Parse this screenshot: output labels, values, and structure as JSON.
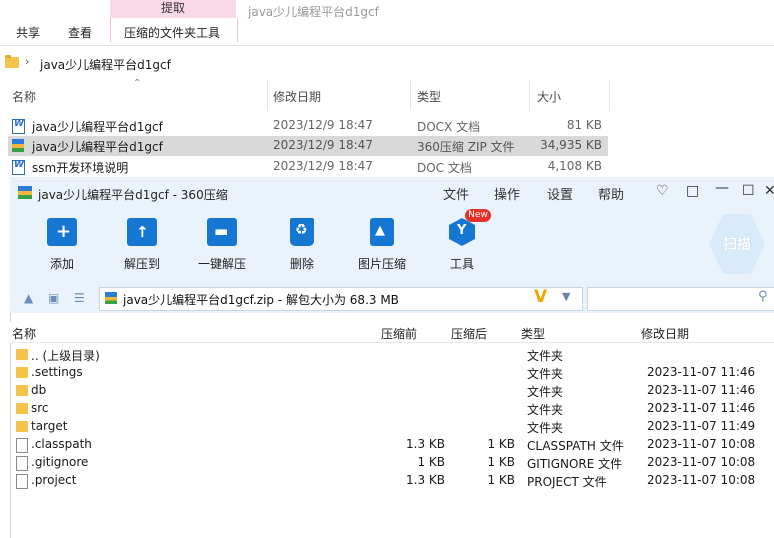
{
  "explorer": {
    "window_title": "java少儿编程平台d1gcf",
    "ribbon_tabs": [
      "共享",
      "查看"
    ],
    "context_tab": "提取",
    "context_group": "压缩的文件夹工具",
    "address_path": "java少儿编程平台d1gcf",
    "columns": [
      "名称",
      "修改日期",
      "类型",
      "大小"
    ],
    "files": [
      {
        "name": "java少儿编程平台d1gcf",
        "date": "2023/12/9 18:47",
        "type": "DOCX 文档",
        "size": "81 KB",
        "icon": "word-doc-icon"
      },
      {
        "name": "java少儿编程平台d1gcf",
        "date": "2023/12/9 18:47",
        "type": "360压缩 ZIP 文件",
        "size": "34,935 KB",
        "icon": "zip-icon",
        "selected": true
      },
      {
        "name": "ssm开发环境说明",
        "date": "2023/12/9 18:47",
        "type": "DOC 文档",
        "size": "4,108 KB",
        "icon": "word-doc-icon"
      }
    ]
  },
  "zip": {
    "title": "java少儿编程平台d1gcf - 360压缩",
    "menu": [
      "文件",
      "操作",
      "设置",
      "帮助"
    ],
    "toolbar": [
      {
        "label": "添加",
        "icon": "add-icon"
      },
      {
        "label": "解压到",
        "icon": "extract-to-icon"
      },
      {
        "label": "一键解压",
        "icon": "one-click-extract-icon"
      },
      {
        "label": "删除",
        "icon": "delete-icon"
      },
      {
        "label": "图片压缩",
        "icon": "image-compress-icon"
      },
      {
        "label": "工具",
        "icon": "tools-icon"
      }
    ],
    "new_badge": "New",
    "scan_label": "扫描",
    "path_text": "java少儿编程平台d1gcf.zip - 解包大小为 68.3 MB",
    "path_v": "V",
    "search_placeholder": "",
    "columns": [
      "名称",
      "压缩前",
      "压缩后",
      "类型",
      "修改日期"
    ],
    "rows": [
      {
        "name": ".. (上级目录)",
        "before": "",
        "after": "",
        "type": "文件夹",
        "date": "",
        "kind": "folder"
      },
      {
        "name": ".settings",
        "before": "",
        "after": "",
        "type": "文件夹",
        "date": "2023-11-07 11:46",
        "kind": "folder"
      },
      {
        "name": "db",
        "before": "",
        "after": "",
        "type": "文件夹",
        "date": "2023-11-07 11:46",
        "kind": "folder"
      },
      {
        "name": "src",
        "before": "",
        "after": "",
        "type": "文件夹",
        "date": "2023-11-07 11:46",
        "kind": "folder"
      },
      {
        "name": "target",
        "before": "",
        "after": "",
        "type": "文件夹",
        "date": "2023-11-07 11:49",
        "kind": "folder"
      },
      {
        "name": ".classpath",
        "before": "1.3 KB",
        "after": "1 KB",
        "type": "CLASSPATH 文件",
        "date": "2023-11-07 10:08",
        "kind": "file"
      },
      {
        "name": ".gitignore",
        "before": "1 KB",
        "after": "1 KB",
        "type": "GITIGNORE 文件",
        "date": "2023-11-07 10:08",
        "kind": "file"
      },
      {
        "name": ".project",
        "before": "1.3 KB",
        "after": "1 KB",
        "type": "PROJECT 文件",
        "date": "2023-11-07 10:08",
        "kind": "file"
      }
    ]
  },
  "colors": {
    "accent": "#1677d2",
    "zip_bg": "#eaf3fc",
    "selected_row": "#d9d9d9",
    "context_tab": "#f9d9e8",
    "badge": "#e8312a"
  }
}
